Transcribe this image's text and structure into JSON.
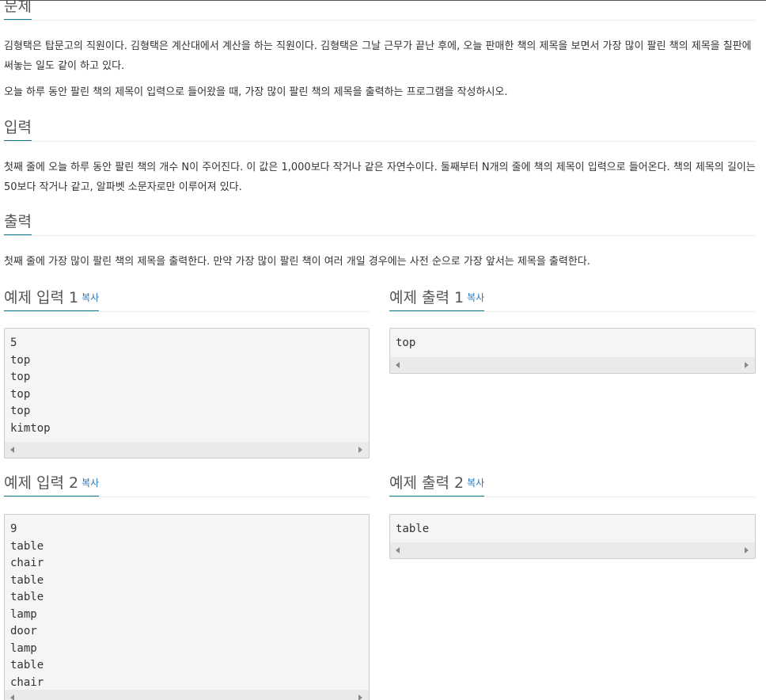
{
  "problem": {
    "title": "문제",
    "paragraphs": [
      "김형택은 탑문고의 직원이다. 김형택은 계산대에서 계산을 하는 직원이다. 김형택은 그날 근무가 끝난 후에, 오늘 판매한 책의 제목을 보면서 가장 많이 팔린 책의 제목을 칠판에 써놓는 일도 같이 하고 있다.",
      "오늘 하루 동안 팔린 책의 제목이 입력으로 들어왔을 때, 가장 많이 팔린 책의 제목을 출력하는 프로그램을 작성하시오."
    ]
  },
  "input": {
    "title": "입력",
    "text": "첫째 줄에 오늘 하루 동안 팔린 책의 개수 N이 주어진다. 이 값은 1,000보다 작거나 같은 자연수이다. 둘째부터 N개의 줄에 책의 제목이 입력으로 들어온다. 책의 제목의 길이는 50보다 작거나 같고, 알파벳 소문자로만 이루어져 있다."
  },
  "output": {
    "title": "출력",
    "text": "첫째 줄에 가장 많이 팔린 책의 제목을 출력한다. 만약 가장 많이 팔린 책이 여러 개일 경우에는 사전 순으로 가장 앞서는 제목을 출력한다."
  },
  "copy_label": "복사",
  "samples": [
    {
      "input_title": "예제 입력 1",
      "input_lines": [
        "5",
        "top",
        "top",
        "top",
        "top",
        "kimtop"
      ],
      "output_title": "예제 출력 1",
      "output_lines": [
        "top"
      ]
    },
    {
      "input_title": "예제 입력 2",
      "input_lines": [
        "9",
        "table",
        "chair",
        "table",
        "table",
        "lamp",
        "door",
        "lamp",
        "table",
        "chair"
      ],
      "output_title": "예제 출력 2",
      "output_lines": [
        "table"
      ]
    }
  ]
}
